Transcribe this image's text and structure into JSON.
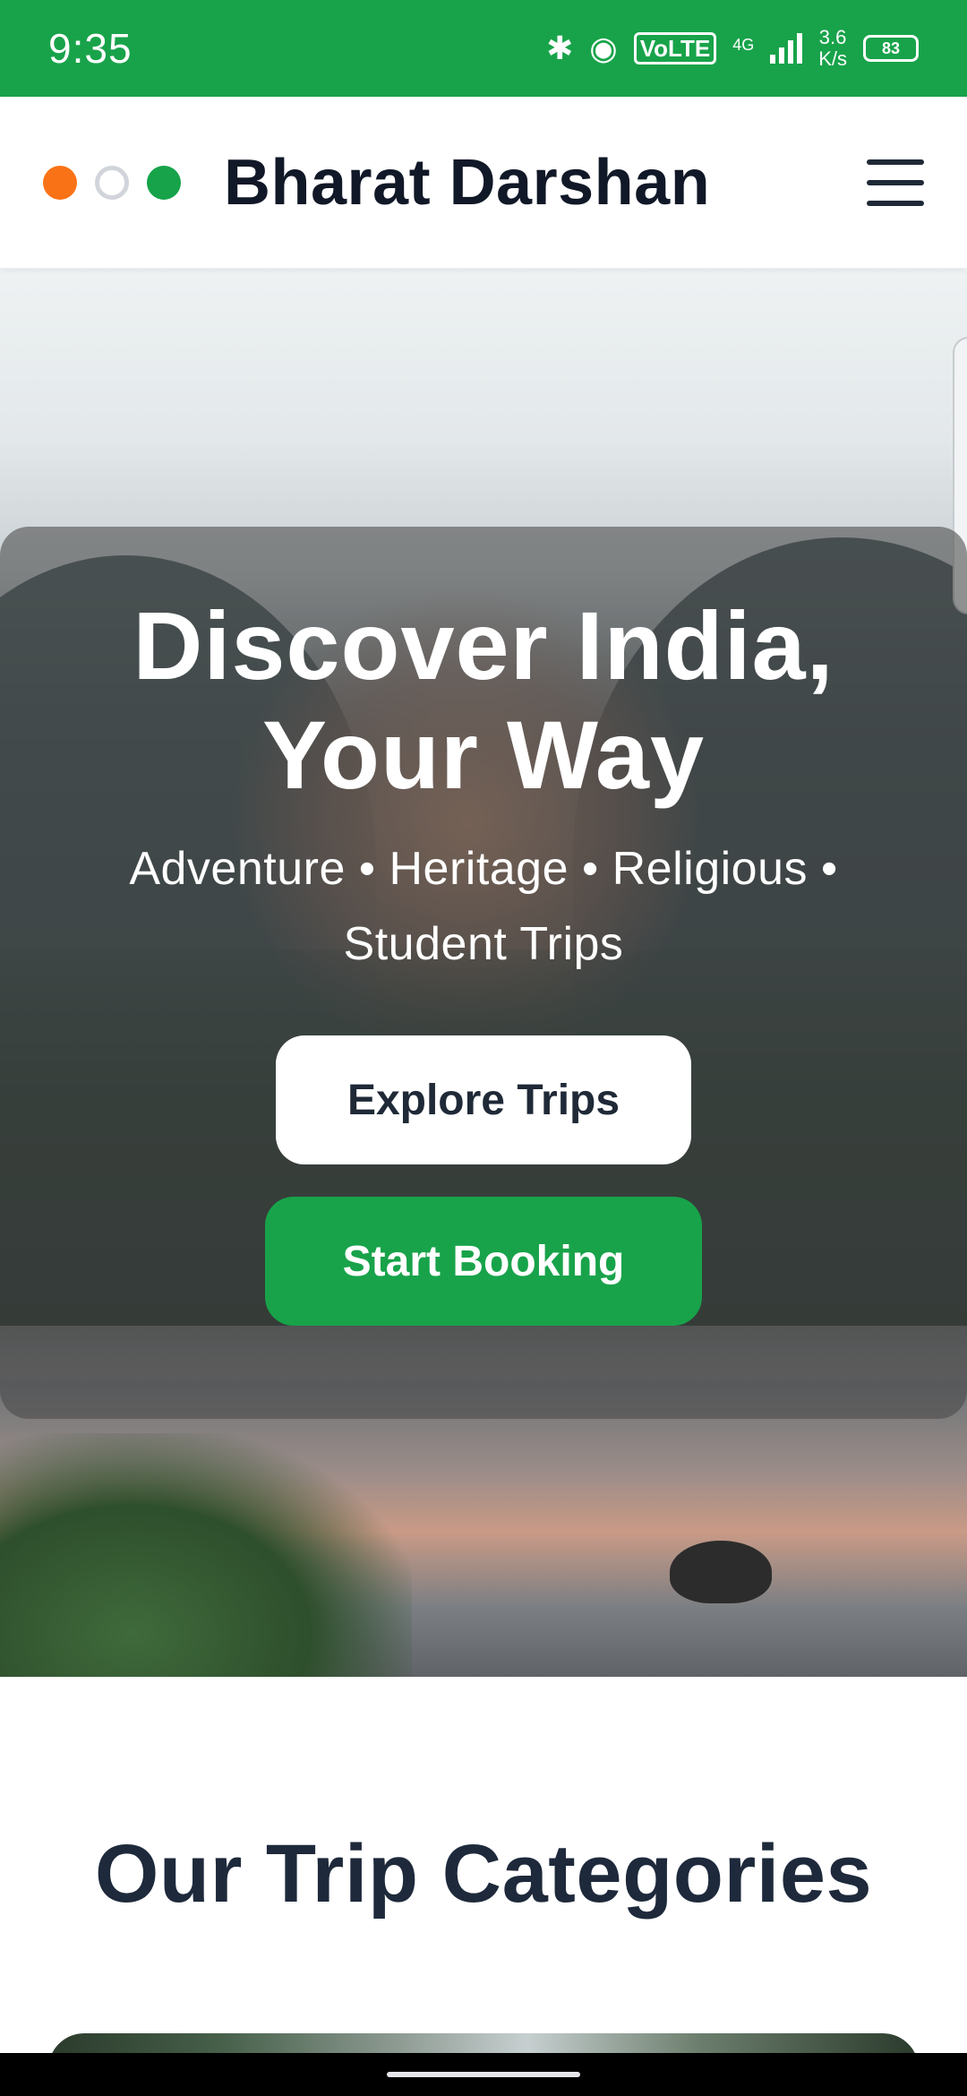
{
  "status_bar": {
    "time": "9:35",
    "network_type": "4G",
    "volte_label": "VoLTE",
    "speed_value": "3.6",
    "speed_unit": "K/s",
    "battery_level": "83",
    "icons": [
      "bluetooth-icon",
      "hotspot-icon",
      "volte-icon",
      "signal-icon",
      "battery-icon"
    ]
  },
  "header": {
    "brand": "Bharat Darshan",
    "logo_dot_colors": [
      "#f97316",
      "#ffffff",
      "#16a34a"
    ],
    "menu_icon": "hamburger-menu-icon"
  },
  "hero": {
    "title": "Discover India, Your Way",
    "subtitle": "Adventure • Heritage • Religious • Student Trips",
    "explore_label": "Explore Trips",
    "booking_label": "Start Booking"
  },
  "categories": {
    "title": "Our Trip Categories"
  },
  "colors": {
    "brand_green": "#18a34a",
    "text_dark": "#111827",
    "heading_navy": "#1e293b"
  }
}
